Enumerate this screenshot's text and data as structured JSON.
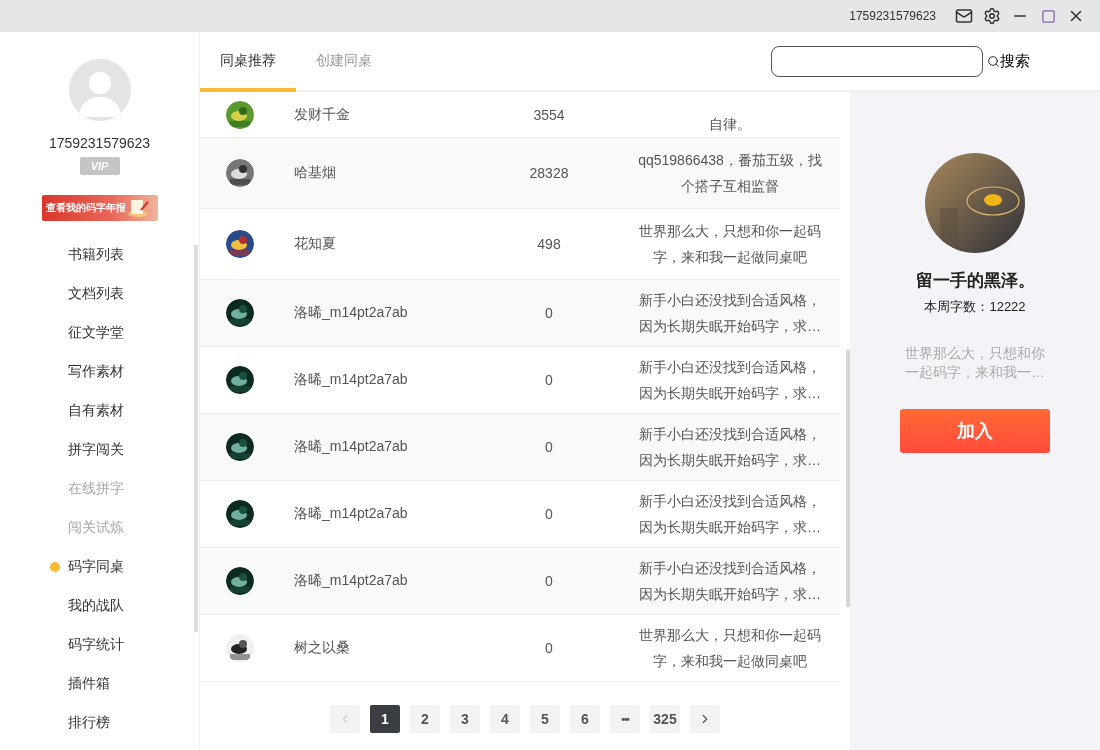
{
  "title_bar": {
    "user_id": "1759231579623"
  },
  "profile": {
    "user_id": "1759231579623",
    "badge": "VIP",
    "banner": "查看我的码字年报"
  },
  "sidebar": {
    "items": [
      {
        "label": "书籍列表",
        "selected": false,
        "disabled": false
      },
      {
        "label": "文档列表",
        "selected": false,
        "disabled": false
      },
      {
        "label": "征文学堂",
        "selected": false,
        "disabled": false
      },
      {
        "label": "写作素材",
        "selected": false,
        "disabled": false
      },
      {
        "label": "自有素材",
        "selected": false,
        "disabled": false
      },
      {
        "label": "拼字闯关",
        "selected": false,
        "disabled": false
      },
      {
        "label": "在线拼字",
        "selected": false,
        "disabled": true
      },
      {
        "label": "闯关试炼",
        "selected": false,
        "disabled": true
      },
      {
        "label": "码字同桌",
        "selected": true,
        "disabled": false
      },
      {
        "label": "我的战队",
        "selected": false,
        "disabled": false
      },
      {
        "label": "码字统计",
        "selected": false,
        "disabled": false
      },
      {
        "label": "插件箱",
        "selected": false,
        "disabled": false
      },
      {
        "label": "排行榜",
        "selected": false,
        "disabled": false
      }
    ]
  },
  "tabs": [
    {
      "label": "同桌推荐",
      "selected": true
    },
    {
      "label": "创建同桌",
      "selected": false
    }
  ],
  "search": {
    "button": "搜索"
  },
  "table": {
    "rows": [
      {
        "name": "发财千金",
        "count": "3554",
        "description": "自律。",
        "partial": true
      },
      {
        "name": "哈基烟",
        "count": "28328",
        "description": "qq519866438，番茄五级，找个搭子互相监督",
        "partial": false
      },
      {
        "name": "花知夏",
        "count": "498",
        "description": "世界那么大，只想和你一起码字，来和我一起做同桌吧",
        "partial": false
      },
      {
        "name": "洛晞_m14pt2a7ab",
        "count": "0",
        "description": "新手小白还没找到合适风格，因为长期失眠开始码字，求…",
        "partial": false
      },
      {
        "name": "洛晞_m14pt2a7ab",
        "count": "0",
        "description": "新手小白还没找到合适风格，因为长期失眠开始码字，求…",
        "partial": false
      },
      {
        "name": "洛晞_m14pt2a7ab",
        "count": "0",
        "description": "新手小白还没找到合适风格，因为长期失眠开始码字，求…",
        "partial": false
      },
      {
        "name": "洛晞_m14pt2a7ab",
        "count": "0",
        "description": "新手小白还没找到合适风格，因为长期失眠开始码字，求…",
        "partial": false
      },
      {
        "name": "洛晞_m14pt2a7ab",
        "count": "0",
        "description": "新手小白还没找到合适风格，因为长期失眠开始码字，求…",
        "partial": false
      },
      {
        "name": "树之以桑",
        "count": "0",
        "description": "世界那么大，只想和你一起码字，来和我一起做同桌吧",
        "partial": false
      }
    ]
  },
  "pagination": {
    "prev_disabled": true,
    "next_disabled": false,
    "items": [
      {
        "label": "1",
        "kind": "page",
        "selected": true
      },
      {
        "label": "2",
        "kind": "page",
        "selected": false
      },
      {
        "label": "3",
        "kind": "page",
        "selected": false
      },
      {
        "label": "4",
        "kind": "page",
        "selected": false
      },
      {
        "label": "5",
        "kind": "page",
        "selected": false
      },
      {
        "label": "6",
        "kind": "page",
        "selected": false
      },
      {
        "label": "•••",
        "kind": "gap",
        "selected": false
      },
      {
        "label": "325",
        "kind": "page",
        "selected": false
      }
    ]
  },
  "detail": {
    "name": "留一手的黑泽。",
    "weekly": "本周字数：12222",
    "description": "世界那么大，只想和你一起码字，来和我一…",
    "button": "加入"
  }
}
